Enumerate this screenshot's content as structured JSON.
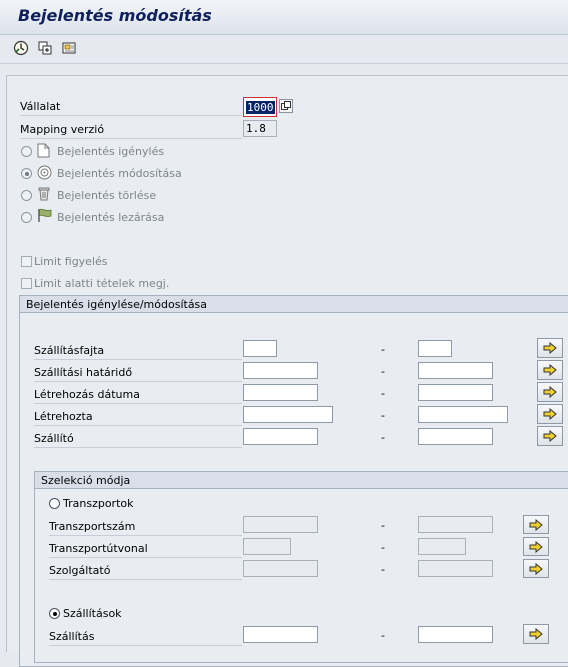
{
  "header": {
    "title": "Bejelentés módosítás"
  },
  "toolbar": {
    "icons": [
      "execute-icon",
      "copy-icon",
      "display-icon"
    ]
  },
  "company": {
    "label": "Vállalat",
    "value": "1000"
  },
  "mapping": {
    "label": "Mapping verzió",
    "value": "1.8"
  },
  "actions": [
    {
      "label": "Bejelentés igénylés"
    },
    {
      "label": "Bejelentés módosítása"
    },
    {
      "label": "Bejelentés törlése"
    },
    {
      "label": "Bejelentés lezárása"
    }
  ],
  "checkboxes": [
    {
      "label": "Limit figyelés"
    },
    {
      "label": "Limit alatti tételek megj."
    }
  ],
  "group1": {
    "title": "Bejelentés igénylése/módosítása",
    "rows": [
      {
        "label": "Szállításfajta",
        "dash": "-"
      },
      {
        "label": "Szállítási határidő",
        "dash": "-"
      },
      {
        "label": "Létrehozás dátuma",
        "dash": "-"
      },
      {
        "label": "Létrehozta",
        "dash": "-"
      },
      {
        "label": "Szállító",
        "dash": "-"
      }
    ]
  },
  "group2": {
    "title": "Szelekció módja",
    "radio_transport": "Transzportok",
    "radio_shipment": "Szállítások",
    "rows": [
      {
        "label": "Transzportszám",
        "dash": "-"
      },
      {
        "label": "Transzportútvonal",
        "dash": "-"
      },
      {
        "label": "Szolgáltató",
        "dash": "-"
      },
      {
        "label": "Szállítás",
        "dash": "-"
      }
    ]
  }
}
